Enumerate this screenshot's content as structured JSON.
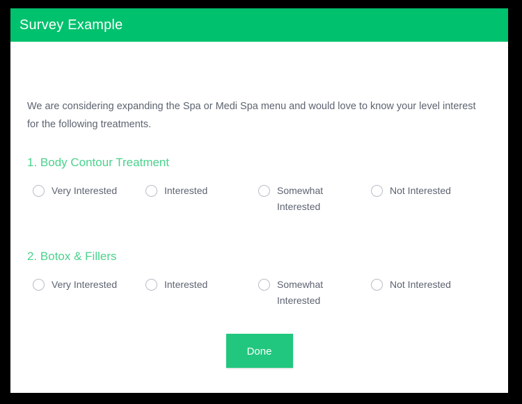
{
  "window": {
    "background_color": "#000000",
    "card_background": "#ffffff"
  },
  "header": {
    "title": "Survey Example",
    "background_color": "#00c16d",
    "text_color": "#ffffff"
  },
  "intro": {
    "text": "We are considering expanding the Spa or Medi Spa menu and would love to know your level interest for the following treatments."
  },
  "questions": [
    {
      "number": "1.",
      "title": "1. Body Contour Treatment",
      "title_color": "#49d28c",
      "options": [
        {
          "label": "Very Interested",
          "selected": false
        },
        {
          "label": "Interested",
          "selected": false
        },
        {
          "label": "Somewhat Interested",
          "selected": false
        },
        {
          "label": "Not Interested",
          "selected": false
        }
      ]
    },
    {
      "number": "2.",
      "title": "2. Botox & Fillers",
      "title_color": "#49d28c",
      "options": [
        {
          "label": "Very Interested",
          "selected": false
        },
        {
          "label": "Interested",
          "selected": false
        },
        {
          "label": "Somewhat Interested",
          "selected": false
        },
        {
          "label": "Not Interested",
          "selected": false
        }
      ]
    }
  ],
  "footer": {
    "submit_label": "Done",
    "submit_color": "#21c77f",
    "submit_text_color": "#ffffff"
  }
}
